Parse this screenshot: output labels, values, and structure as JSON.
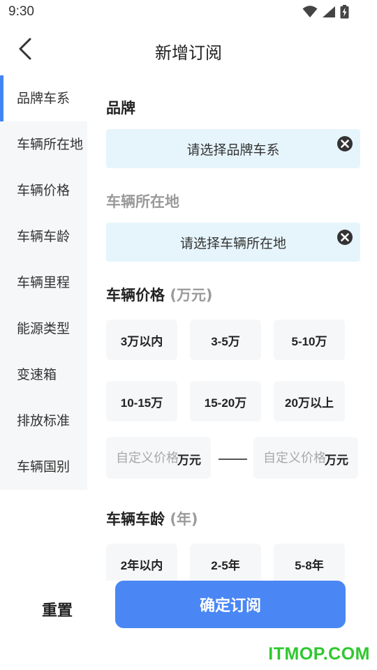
{
  "status_bar": {
    "time": "9:30",
    "icons": [
      "wifi-icon",
      "signal-icon",
      "battery-charging-icon"
    ]
  },
  "header": {
    "title": "新增订阅",
    "back_icon": "chevron-left-icon"
  },
  "sidebar": {
    "items": [
      {
        "label": "品牌车系",
        "active": true
      },
      {
        "label": "车辆所在地",
        "active": false
      },
      {
        "label": "车辆价格",
        "active": false
      },
      {
        "label": "车辆车龄",
        "active": false
      },
      {
        "label": "车辆里程",
        "active": false
      },
      {
        "label": "能源类型",
        "active": false
      },
      {
        "label": "变速箱",
        "active": false
      },
      {
        "label": "排放标准",
        "active": false
      },
      {
        "label": "车辆国别",
        "active": false
      }
    ]
  },
  "brand": {
    "title": "品牌",
    "placeholder": "请选择品牌车系"
  },
  "location": {
    "title": "车辆所在地",
    "placeholder": "请选择车辆所在地"
  },
  "price": {
    "title": "车辆价格",
    "unit": "(万元)",
    "options": [
      "3万以内",
      "3-5万",
      "5-10万",
      "10-15万",
      "15-20万",
      "20万以上"
    ],
    "custom_min_placeholder": "自定义价格",
    "custom_max_placeholder": "自定义价格",
    "custom_unit": "万元"
  },
  "age": {
    "title": "车辆车龄",
    "unit": "(年)",
    "options": [
      "2年以内",
      "2-5年",
      "5-8年"
    ]
  },
  "footer": {
    "reset_label": "重置",
    "confirm_label": "确定订阅"
  },
  "watermark": "ITMOP.COM",
  "colors": {
    "accent": "#4a87f5",
    "select_bg": "#e6f5fc",
    "chip_bg": "#f6f7f9",
    "watermark": "#2ec82e"
  }
}
